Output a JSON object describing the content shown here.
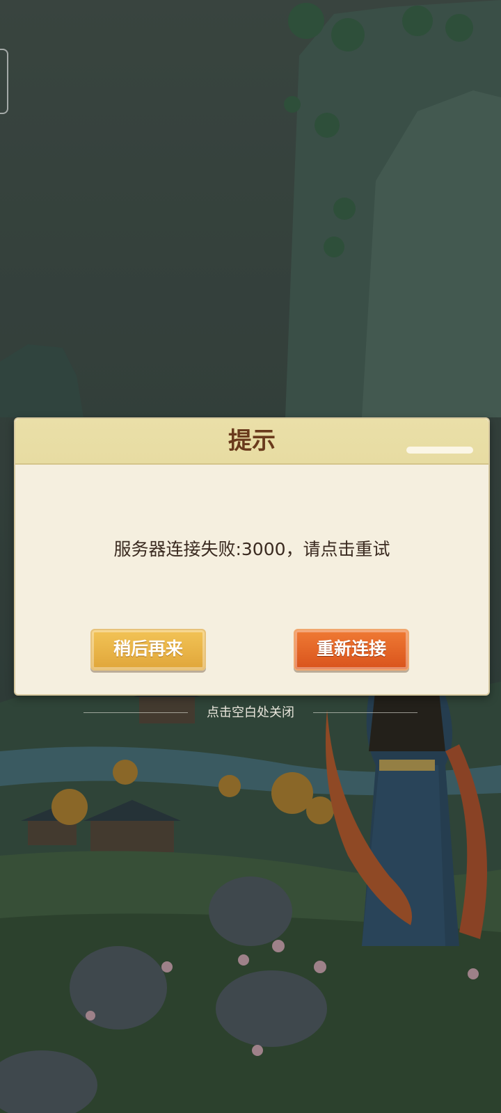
{
  "dialog": {
    "title": "提示",
    "message": "服务器连接失败:3000，请点击重试",
    "buttons": {
      "later": "稍后再来",
      "retry": "重新连接"
    }
  },
  "close_hint": "点击空白处关闭",
  "colors": {
    "dialog_bg": "#f5efdf",
    "header_bg": "#e7dca2",
    "title_text": "#6a3a1c",
    "later_button": "#e0a63a",
    "retry_button": "#d9531c"
  }
}
